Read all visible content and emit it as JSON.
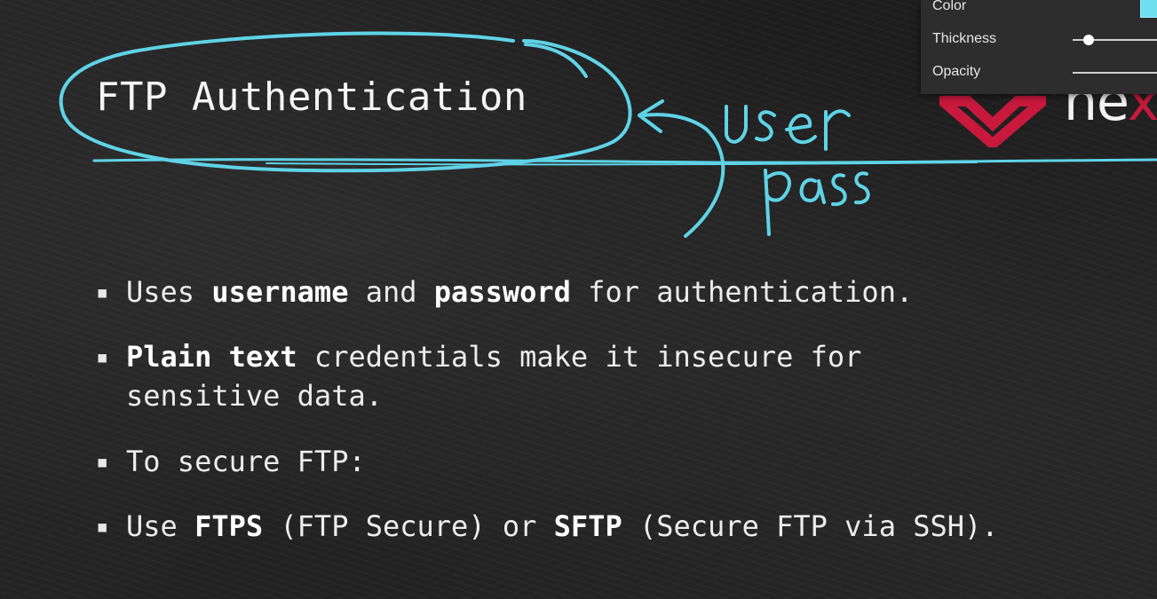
{
  "slide": {
    "title": "FTP Authentication",
    "bullets": [
      {
        "marker": "▪",
        "parts": [
          {
            "text": "Uses "
          },
          {
            "text": "username",
            "bold": true
          },
          {
            "text": " and "
          },
          {
            "text": "password",
            "bold": true
          },
          {
            "text": " for authentication."
          }
        ]
      },
      {
        "marker": "▪",
        "parts": [
          {
            "text": "Plain text",
            "bold": true
          },
          {
            "text": " credentials make it insecure for"
          }
        ],
        "continuation": "sensitive data."
      },
      {
        "marker": "▪",
        "parts": [
          {
            "text": "To secure FTP:"
          }
        ]
      },
      {
        "marker": "▪",
        "parts": [
          {
            "text": "Use "
          },
          {
            "text": "FTPS",
            "bold": true
          },
          {
            "text": " (FTP Secure) or "
          },
          {
            "text": "SFTP",
            "bold": true
          },
          {
            "text": " (Secure FTP via SSH)."
          }
        ]
      }
    ]
  },
  "annotations": {
    "handwriting": [
      "user",
      "pass"
    ],
    "ink_color": "#5fd3e6"
  },
  "brand": {
    "text_white": "ne",
    "text_accent": "x",
    "accent_color": "#c8193c",
    "icon": "chevron-logo-icon"
  },
  "pen_panel": {
    "color_label": "Color",
    "color_value": "#6fe0f0",
    "thickness_label": "Thickness",
    "thickness_level": 0.15,
    "opacity_label": "Opacity",
    "opacity_level": 0.9
  }
}
